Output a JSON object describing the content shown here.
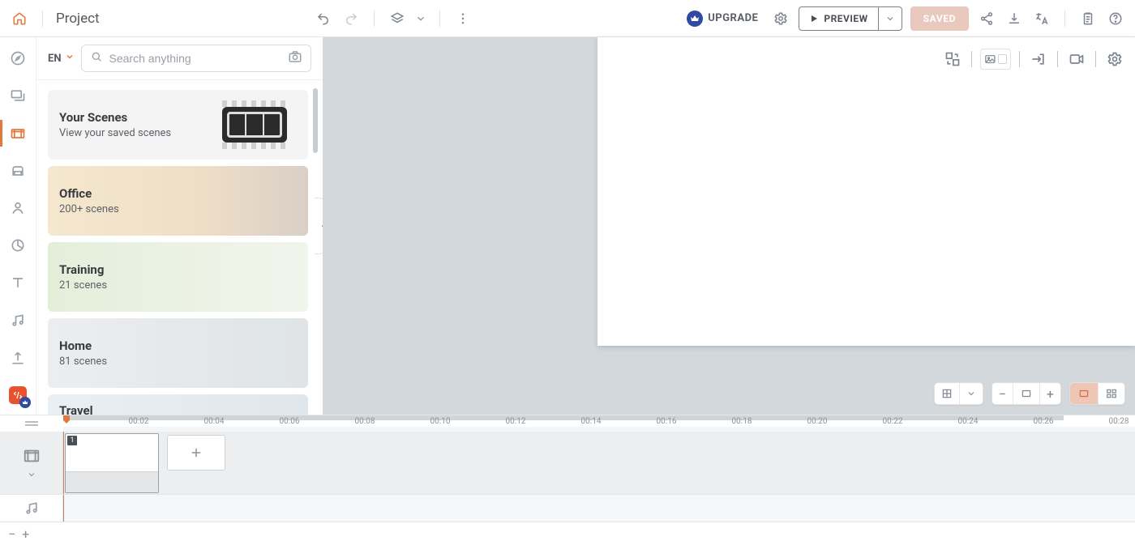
{
  "topbar": {
    "title": "Project",
    "upgrade_label": "UPGRADE",
    "preview_label": "PREVIEW",
    "saved_label": "SAVED"
  },
  "library": {
    "language": "EN",
    "search_placeholder": "Search anything",
    "cards": [
      {
        "title": "Your Scenes",
        "subtitle": "View your saved scenes"
      },
      {
        "title": "Office",
        "subtitle": "200+ scenes"
      },
      {
        "title": "Training",
        "subtitle": "21 scenes"
      },
      {
        "title": "Home",
        "subtitle": "81 scenes"
      },
      {
        "title": "Travel",
        "subtitle": ""
      }
    ]
  },
  "timeline": {
    "ticks": [
      "00:02",
      "00:04",
      "00:06",
      "00:08",
      "00:10",
      "00:12",
      "00:14",
      "00:16",
      "00:18",
      "00:20",
      "00:22",
      "00:24",
      "00:26",
      "00:28"
    ],
    "clip_number": "1"
  }
}
